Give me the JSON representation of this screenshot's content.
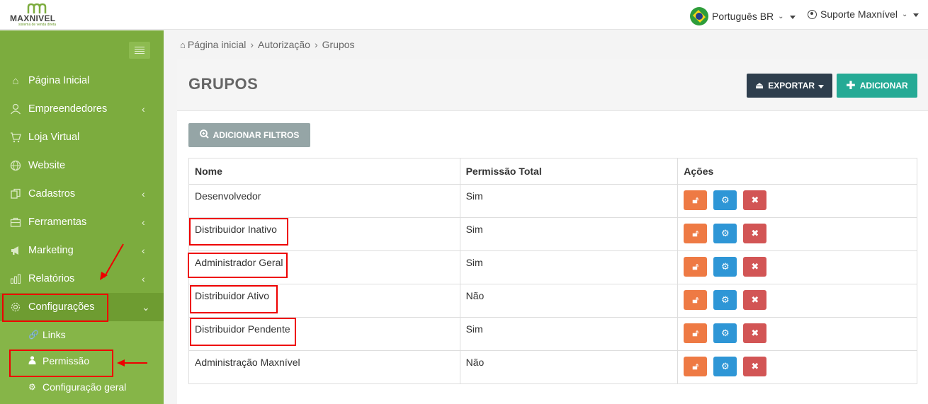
{
  "brand": {
    "name": "MAXNIVEL",
    "tagline": "sistema de venda direta"
  },
  "topbar": {
    "language": "Português BR",
    "user": "Suporte Maxnível"
  },
  "sidebar": {
    "items": [
      {
        "label": "Página Inicial",
        "icon": "home-icon",
        "arrow": ""
      },
      {
        "label": "Empreendedores",
        "icon": "user-icon",
        "arrow": "‹"
      },
      {
        "label": "Loja Virtual",
        "icon": "cart-icon",
        "arrow": ""
      },
      {
        "label": "Website",
        "icon": "globe-icon",
        "arrow": ""
      },
      {
        "label": "Cadastros",
        "icon": "copy-icon",
        "arrow": "‹"
      },
      {
        "label": "Ferramentas",
        "icon": "briefcase-icon",
        "arrow": "‹"
      },
      {
        "label": "Marketing",
        "icon": "megaphone-icon",
        "arrow": "‹"
      },
      {
        "label": "Relatórios",
        "icon": "bar-chart-icon",
        "arrow": "‹"
      },
      {
        "label": "Configurações",
        "icon": "gear-icon",
        "arrow": "⌄"
      }
    ],
    "submenu": [
      {
        "label": "Links",
        "icon": "link-icon"
      },
      {
        "label": "Permissão",
        "icon": "person-icon"
      },
      {
        "label": "Configuração geral",
        "icon": "cog-icon"
      }
    ]
  },
  "breadcrumb": {
    "home": "Página inicial",
    "level2": "Autorização",
    "level3": "Grupos"
  },
  "page": {
    "title": "GRUPOS",
    "export_label": "EXPORTAR",
    "add_label": "ADICIONAR",
    "filter_label": "ADICIONAR FILTROS"
  },
  "table": {
    "headers": [
      "Nome",
      "Permissão Total",
      "Ações"
    ],
    "rows": [
      {
        "name": "Desenvolvedor",
        "total": "Sim"
      },
      {
        "name": "Distribuidor Inativo",
        "total": "Sim"
      },
      {
        "name": "Administrador Geral",
        "total": "Sim"
      },
      {
        "name": "Distribuidor Ativo",
        "total": "Não"
      },
      {
        "name": "Distribuidor Pendente",
        "total": "Sim"
      },
      {
        "name": "Administração Maxnível",
        "total": "Não"
      }
    ]
  },
  "colors": {
    "sidebar": "#7cac3e",
    "export": "#2e3e4d",
    "add": "#25aa95",
    "lock": "#ee7a44",
    "settings": "#2e96d6",
    "delete": "#d25555",
    "annotation": "#ee0000"
  }
}
